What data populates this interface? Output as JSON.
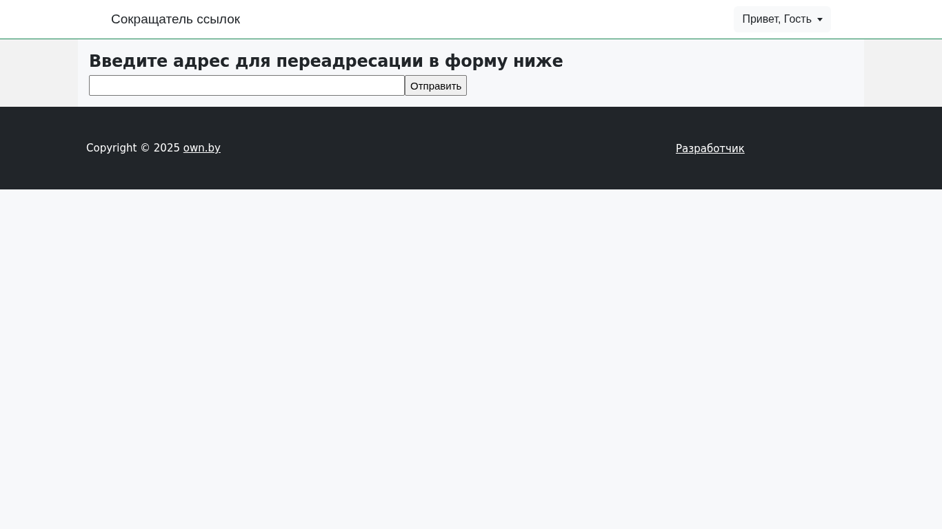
{
  "header": {
    "brand": "Сокращатель ссылок",
    "user_menu": {
      "label": "Привет, Гость",
      "expanded": false
    }
  },
  "form": {
    "heading": "Введите адрес для переадресации в форму ниже",
    "submit": "Отправить"
  },
  "footer": {
    "copyright": "Copyright © 2025",
    "site_link": "own.by",
    "developer_link": "Разработчик"
  }
}
